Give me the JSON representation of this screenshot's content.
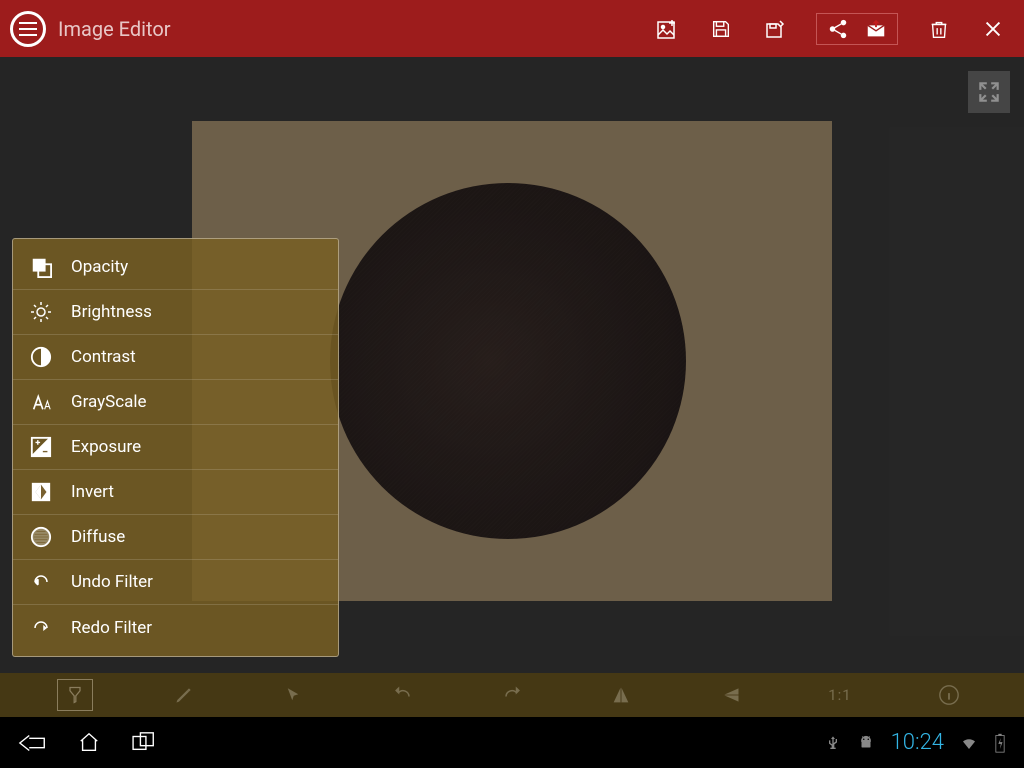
{
  "header": {
    "title": "Image Editor"
  },
  "menu": {
    "items": [
      {
        "label": "Opacity",
        "icon": "opacity"
      },
      {
        "label": "Brightness",
        "icon": "brightness"
      },
      {
        "label": "Contrast",
        "icon": "contrast"
      },
      {
        "label": "GrayScale",
        "icon": "grayscale"
      },
      {
        "label": "Exposure",
        "icon": "exposure"
      },
      {
        "label": "Invert",
        "icon": "invert"
      },
      {
        "label": "Diffuse",
        "icon": "diffuse"
      },
      {
        "label": "Undo Filter",
        "icon": "undo"
      },
      {
        "label": "Redo Filter",
        "icon": "redo"
      }
    ]
  },
  "toolbar": {
    "ratio_label": "1:1"
  },
  "statusbar": {
    "time": "10:24"
  }
}
